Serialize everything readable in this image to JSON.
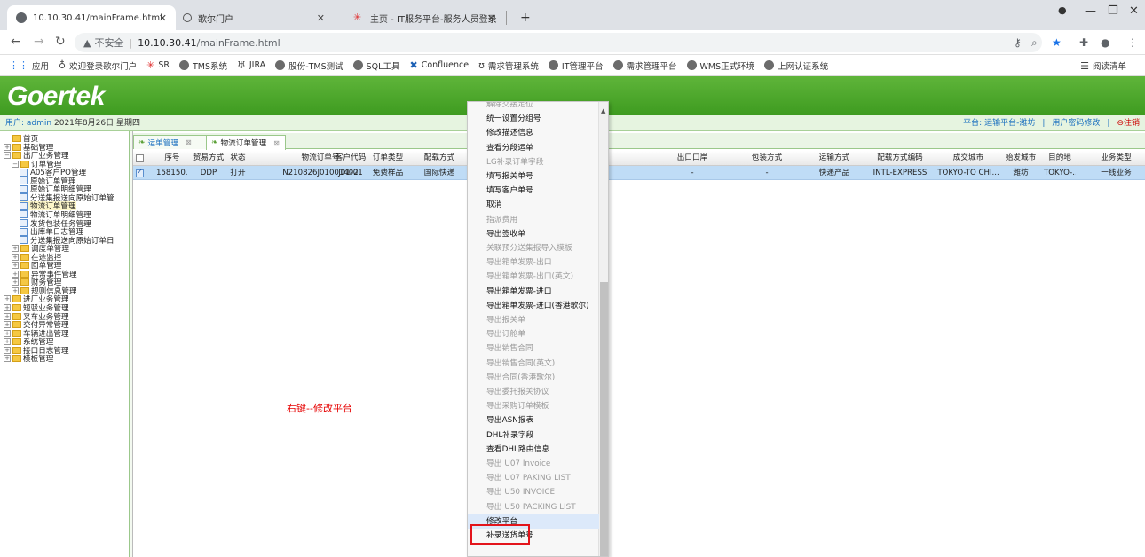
{
  "browser": {
    "tabs": [
      {
        "title": "10.10.30.41/mainFrame.html",
        "active": true
      },
      {
        "title": "歌尔门户",
        "active": false
      },
      {
        "title": "主页 - IT服务平台-服务人员登录",
        "active": false
      }
    ],
    "new_tab": "+",
    "address": {
      "insecure_label": "不安全",
      "host": "10.10.30.41",
      "path": "/mainFrame.html"
    },
    "bookmarks": [
      "应用",
      "欢迎登录歌尔门户",
      "SR",
      "TMS系统",
      "JIRA",
      "股份-TMS测试",
      "SQL工具",
      "Confluence",
      "需求管理系统",
      "IT管理平台",
      "需求管理平台",
      "WMS正式环境",
      "上网认证系统"
    ],
    "reading_list": "阅读清单"
  },
  "app": {
    "logo": "Goertek",
    "brand_color": "#4aa82a",
    "user_label": "用户:",
    "user": "admin",
    "date": "2021年8月26日 星期四",
    "top_links": [
      "平台: 运输平台-潍坊",
      "用户密码修改",
      "注销"
    ]
  },
  "tree": [
    {
      "label": "首页",
      "level": 0
    },
    {
      "label": "基础管理",
      "level": 0
    },
    {
      "label": "出厂业务管理",
      "level": 0
    },
    {
      "label": "订单管理",
      "level": 1
    },
    {
      "label": "A05客户PO管理",
      "level": 2
    },
    {
      "label": "原始订单管理",
      "level": 2
    },
    {
      "label": "原始订单明细管理",
      "level": 2
    },
    {
      "label": "分送集报送向原始订单管",
      "level": 2
    },
    {
      "label": "物流订单管理",
      "level": 2,
      "selected": true
    },
    {
      "label": "物流订单明细管理",
      "level": 2
    },
    {
      "label": "发货包装任务管理",
      "level": 2
    },
    {
      "label": "出库单日志管理",
      "level": 2
    },
    {
      "label": "分送集报送向原始订单日",
      "level": 2
    },
    {
      "label": "调度单管理",
      "level": 1
    },
    {
      "label": "在途监控",
      "level": 1
    },
    {
      "label": "回单管理",
      "level": 1
    },
    {
      "label": "异常事件管理",
      "level": 1
    },
    {
      "label": "财务管理",
      "level": 1
    },
    {
      "label": "规则信息管理",
      "level": 1
    },
    {
      "label": "进厂业务管理",
      "level": 0
    },
    {
      "label": "短驳业务管理",
      "level": 0
    },
    {
      "label": "叉车业务管理",
      "level": 0
    },
    {
      "label": "交付异常管理",
      "level": 0
    },
    {
      "label": "车辆进出管理",
      "level": 0
    },
    {
      "label": "系统管理",
      "level": 0
    },
    {
      "label": "接口日志管理",
      "level": 0
    },
    {
      "label": "模板管理",
      "level": 0
    }
  ],
  "work_tabs": [
    {
      "label": "运单管理",
      "active": false
    },
    {
      "label": "物流订单管理",
      "active": true
    }
  ],
  "grid": {
    "columns": [
      "序号",
      "贸易方式",
      "状态",
      "物流订单号",
      "客户代码",
      "订单类型",
      "配载方式",
      "出口口岸",
      "包装方式",
      "运输方式",
      "配载方式编码",
      "成交城市",
      "始发城市",
      "目的地",
      "业务类型"
    ],
    "rows": [
      [
        "158150...",
        "DDP",
        "打开",
        "N210826J01001402",
        "J01-01",
        "免费样品",
        "国际快递",
        "-",
        "-",
        "快递产品",
        "INTL-EXPRESS",
        "TOKYO-TO CHI...",
        "潍坊",
        "TOKYO-...",
        "一线业务"
      ]
    ]
  },
  "annotation": "右键--修改平台",
  "context_menu": {
    "items": [
      {
        "label": "解除交接定位",
        "disabled": true
      },
      {
        "label": "统一设置分组号",
        "disabled": false
      },
      {
        "label": "修改描述信息",
        "disabled": false
      },
      {
        "label": "查看分段运单",
        "disabled": false
      },
      {
        "label": "LG补录订单字段",
        "disabled": true
      },
      {
        "label": "填写报关单号",
        "disabled": false
      },
      {
        "label": "填写客户单号",
        "disabled": false
      },
      {
        "label": "取消",
        "disabled": false
      },
      {
        "label": "指派费用",
        "disabled": true
      },
      {
        "label": "导出签收单",
        "disabled": false
      },
      {
        "label": "关联预分送集报导入模板",
        "disabled": true
      },
      {
        "label": "导出箱单发票-出口",
        "disabled": true
      },
      {
        "label": "导出箱单发票-出口(英文)",
        "disabled": true
      },
      {
        "label": "导出箱单发票-进口",
        "disabled": false
      },
      {
        "label": "导出箱单发票-进口(香港歌尔)",
        "disabled": false
      },
      {
        "label": "导出报关单",
        "disabled": true
      },
      {
        "label": "导出订舱单",
        "disabled": true
      },
      {
        "label": "导出销售合同",
        "disabled": true
      },
      {
        "label": "导出销售合同(英文)",
        "disabled": true
      },
      {
        "label": "导出合同(香港歌尔)",
        "disabled": true
      },
      {
        "label": "导出委托报关协议",
        "disabled": true
      },
      {
        "label": "导出采购订单模板",
        "disabled": true
      },
      {
        "label": "导出ASN报表",
        "disabled": false
      },
      {
        "label": "DHL补录字段",
        "disabled": false
      },
      {
        "label": "查看DHL路由信息",
        "disabled": false
      },
      {
        "label": "导出 U07 Invoice",
        "disabled": true
      },
      {
        "label": "导出 U07 PAKING LIST",
        "disabled": true
      },
      {
        "label": "导出 U50 INVOICE",
        "disabled": true
      },
      {
        "label": "导出 U50 PACKING LIST",
        "disabled": true
      },
      {
        "label": "修改平台",
        "disabled": false,
        "highlighted": true
      },
      {
        "label": "补录送货单号",
        "disabled": false
      }
    ]
  }
}
